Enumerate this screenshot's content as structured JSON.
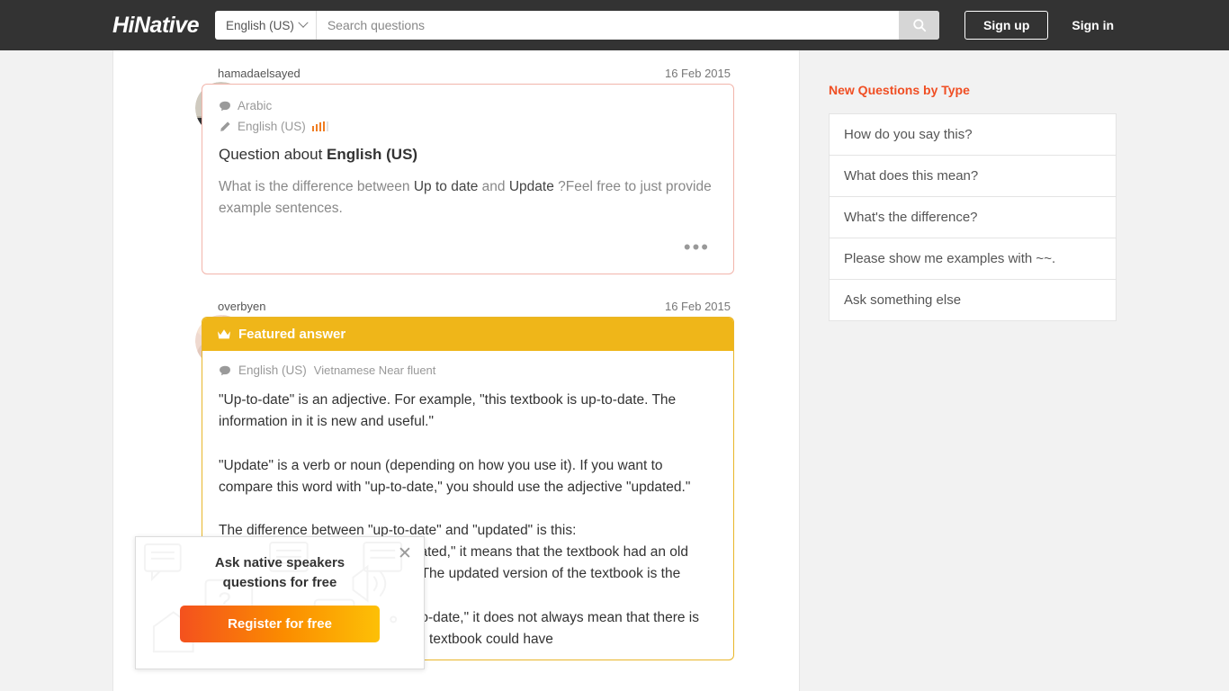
{
  "header": {
    "logo": "HiNative",
    "language_selector": "English (US)",
    "search_placeholder": "Search questions",
    "search_value": "",
    "search_icon": "search-icon",
    "signup_label": "Sign up",
    "signin_label": "Sign in"
  },
  "question": {
    "username": "hamadaelsayed",
    "timestamp": "16 Feb 2015",
    "native_language": "Arabic",
    "learning_language": "English (US)",
    "proficiency_filled": 4,
    "proficiency_total": 5,
    "title_prefix": "Question about ",
    "title_language": "English (US)",
    "body_pre": "What is the difference between ",
    "body_term1": "Up to date",
    "body_mid": " and ",
    "body_term2": "Update",
    "body_post": " ?Feel free to just provide example sentences.",
    "more_menu": "•••"
  },
  "answer": {
    "username": "overbyen",
    "timestamp": "16 Feb 2015",
    "featured_label": "Featured answer",
    "crown_icon": "crown-icon",
    "language": "English (US)",
    "language_sub": "Vietnamese Near fluent",
    "text": "\"Up-to-date\" is an adjective. For example, \"this textbook is up-to-date. The information in it is new and useful.\"\n\n\"Update\" is a verb or noun (depending on how you use it). If you want to compare this word with \"up-to-date,\" you should use the adjective \"updated.\"\n\nThe difference between \"up-to-date\" and \"updated\" is this:\nIf you say that a textbook is \"updated,\" it means that the textbook had an old version with old information in it. The updated version of the textbook is the newer (and better) version.\nIf you say that a textbook is \"up-to-date,\" it does not always mean that there is an older version somewhere. The textbook could have"
  },
  "sidebar": {
    "title": "New Questions by Type",
    "items": [
      {
        "label": "How do you say this?"
      },
      {
        "label": "What does this mean?"
      },
      {
        "label": "What's the difference?"
      },
      {
        "label": "Please show me examples with ~~."
      },
      {
        "label": "Ask something else"
      }
    ]
  },
  "promo": {
    "title": "Ask native speakers\nquestions for free",
    "button_label": "Register for free",
    "close_icon": "close-icon"
  },
  "colors": {
    "header_bg": "#333333",
    "accent_orange": "#f04e23",
    "featured_gold": "#efb619",
    "question_border": "#f2b5ab",
    "proficiency_bar": "#f07d21",
    "page_bg": "#f2f2f2"
  }
}
